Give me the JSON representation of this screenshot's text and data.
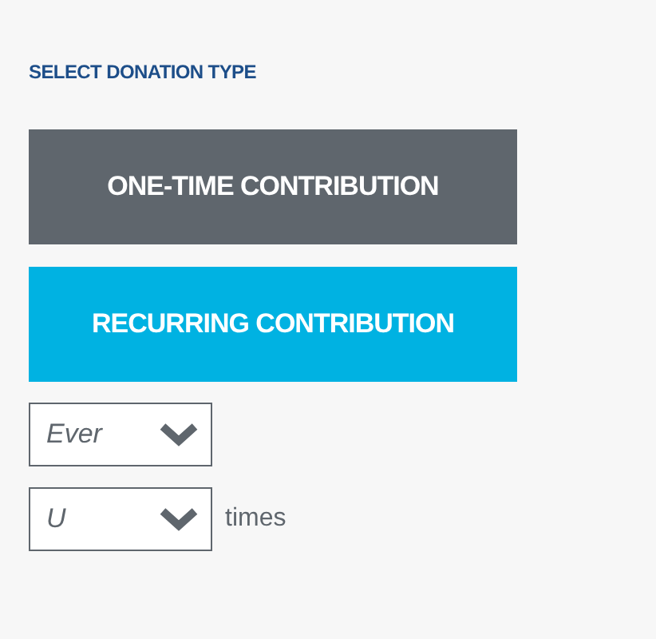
{
  "heading": "SELECT DONATION TYPE",
  "donation_types": [
    {
      "label": "ONE-TIME CONTRIBUTION",
      "selected": false
    },
    {
      "label": "RECURRING CONTRIBUTION",
      "selected": true
    }
  ],
  "frequency_select": {
    "value": "Ever"
  },
  "count_select": {
    "value": "U",
    "suffix": "times"
  }
}
